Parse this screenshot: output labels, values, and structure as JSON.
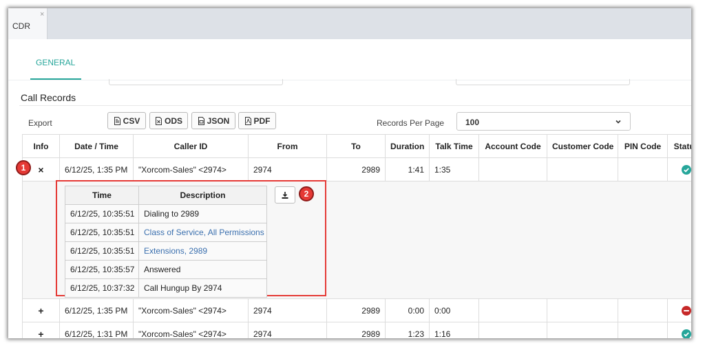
{
  "window": {
    "tab_label": "CDR",
    "tab_close": "×"
  },
  "general_tab": "GENERAL",
  "section_title": "Call Records",
  "toolbar": {
    "export_label": "Export",
    "csv_label": "CSV",
    "ods_label": "ODS",
    "json_label": "JSON",
    "pdf_label": "PDF",
    "records_per_page_label": "Records Per Page",
    "records_per_page_value": "100"
  },
  "table": {
    "headers": [
      "Info",
      "Date / Time",
      "Caller ID",
      "From",
      "To",
      "Duration",
      "Talk Time",
      "Account Code",
      "Customer Code",
      "PIN Code",
      "Status"
    ],
    "rows": [
      {
        "toggle": "×",
        "datetime": "6/12/25, 1:35 PM",
        "caller_id": "\"Xorcom-Sales\" <2974>",
        "from": "2974",
        "to": "2989",
        "duration": "1:41",
        "talk_time": "1:35",
        "account_code": "",
        "customer_code": "",
        "pin_code": "",
        "status": "answered",
        "expanded": true
      },
      {
        "toggle": "+",
        "datetime": "6/12/25, 1:35 PM",
        "caller_id": "\"Xorcom-Sales\" <2974>",
        "from": "2974",
        "to": "2989",
        "duration": "0:00",
        "talk_time": "0:00",
        "account_code": "",
        "customer_code": "",
        "pin_code": "",
        "status": "failed"
      },
      {
        "toggle": "+",
        "datetime": "6/12/25, 1:31 PM",
        "caller_id": "\"Xorcom-Sales\" <2974>",
        "from": "2974",
        "to": "2989",
        "duration": "1:23",
        "talk_time": "1:16",
        "account_code": "",
        "customer_code": "",
        "pin_code": "",
        "status": "answered"
      }
    ]
  },
  "detail": {
    "headers": [
      "Time",
      "Description"
    ],
    "rows": [
      {
        "time": "6/12/25, 10:35:51",
        "description": "Dialing to 2989",
        "link": false
      },
      {
        "time": "6/12/25, 10:35:51",
        "description": "Class of Service, All Permissions",
        "link": true
      },
      {
        "time": "6/12/25, 10:35:51",
        "description": "Extensions, 2989",
        "link": true
      },
      {
        "time": "6/12/25, 10:35:57",
        "description": "Answered",
        "link": false
      },
      {
        "time": "6/12/25, 10:37:32",
        "description": "Call Hungup By 2974",
        "link": false
      }
    ]
  },
  "annotations": {
    "badge_1": "1",
    "badge_2": "2"
  },
  "colors": {
    "accent": "#26a69a",
    "status_answered": "#26a69a",
    "status_failed": "#c62828",
    "highlight": "#e53935",
    "link": "#3a6fae"
  },
  "icons": {
    "export_file": "document-icon",
    "download": "download-icon",
    "status_answered": "check-circle-icon",
    "status_failed": "minus-circle-icon",
    "select_chevron": "chevron-down-icon"
  }
}
